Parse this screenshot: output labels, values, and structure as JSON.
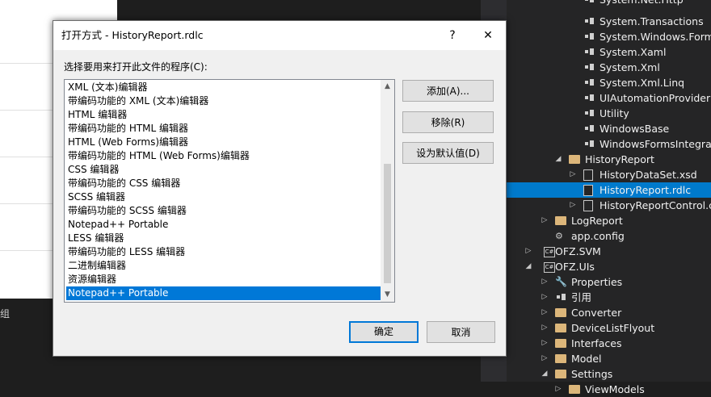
{
  "background": {
    "bottom_left_text": "组"
  },
  "solution_explorer": {
    "nodes": [
      {
        "label": "System.Net.Http",
        "icon": "reference-icon"
      },
      {
        "label": "System.Transactions",
        "icon": "reference-icon"
      },
      {
        "label": "System.Windows.Forms",
        "icon": "reference-icon"
      },
      {
        "label": "System.Xaml",
        "icon": "reference-icon"
      },
      {
        "label": "System.Xml",
        "icon": "reference-icon"
      },
      {
        "label": "System.Xml.Linq",
        "icon": "reference-icon"
      },
      {
        "label": "UIAutomationProvider",
        "icon": "reference-icon"
      },
      {
        "label": "Utility",
        "icon": "reference-icon"
      },
      {
        "label": "WindowsBase",
        "icon": "reference-icon"
      },
      {
        "label": "WindowsFormsIntegration",
        "icon": "reference-icon"
      },
      {
        "label": "HistoryReport",
        "icon": "folder-icon"
      },
      {
        "label": "HistoryDataSet.xsd",
        "icon": "file-icon"
      },
      {
        "label": "HistoryReport.rdlc",
        "icon": "file-icon"
      },
      {
        "label": "HistoryReportControl.cs",
        "icon": "file-icon"
      },
      {
        "label": "LogReport",
        "icon": "folder-icon"
      },
      {
        "label": "app.config",
        "icon": "config-icon"
      },
      {
        "label": "OFZ.SVM",
        "icon": "csharp-project-icon"
      },
      {
        "label": "OFZ.UIs",
        "icon": "csharp-project-icon"
      },
      {
        "label": "Properties",
        "icon": "wrench-icon"
      },
      {
        "label": "引用",
        "icon": "reference-icon"
      },
      {
        "label": "Converter",
        "icon": "folder-icon"
      },
      {
        "label": "DeviceListFlyout",
        "icon": "folder-icon"
      },
      {
        "label": "Interfaces",
        "icon": "folder-icon"
      },
      {
        "label": "Model",
        "icon": "folder-icon"
      },
      {
        "label": "Settings",
        "icon": "folder-icon"
      },
      {
        "label": "ViewModels",
        "icon": "folder-icon"
      }
    ],
    "selected": "HistoryReport.rdlc",
    "selection_color": "#007acc"
  },
  "dialog": {
    "title": "打开方式 - HistoryReport.rdlc",
    "help_label": "?",
    "close_label": "✕",
    "prompt": "选择要用来打开此文件的程序(C):",
    "programs": [
      "XML (文本)编辑器",
      "带编码功能的 XML (文本)编辑器",
      "HTML 编辑器",
      "带编码功能的 HTML 编辑器",
      "HTML (Web Forms)编辑器",
      "带编码功能的 HTML (Web Forms)编辑器",
      "CSS 编辑器",
      "带编码功能的 CSS 编辑器",
      "SCSS 编辑器",
      "带编码功能的 SCSS 编辑器",
      "Notepad++ Portable",
      "LESS 编辑器",
      "带编码功能的 LESS 编辑器",
      "二进制编辑器",
      "资源编辑器",
      "Notepad++ Portable"
    ],
    "selected_index": 15,
    "buttons": {
      "add": "添加(A)...",
      "remove": "移除(R)",
      "set_default": "设为默认值(D)",
      "ok": "确定",
      "cancel": "取消"
    },
    "accent_color": "#0078d7"
  }
}
